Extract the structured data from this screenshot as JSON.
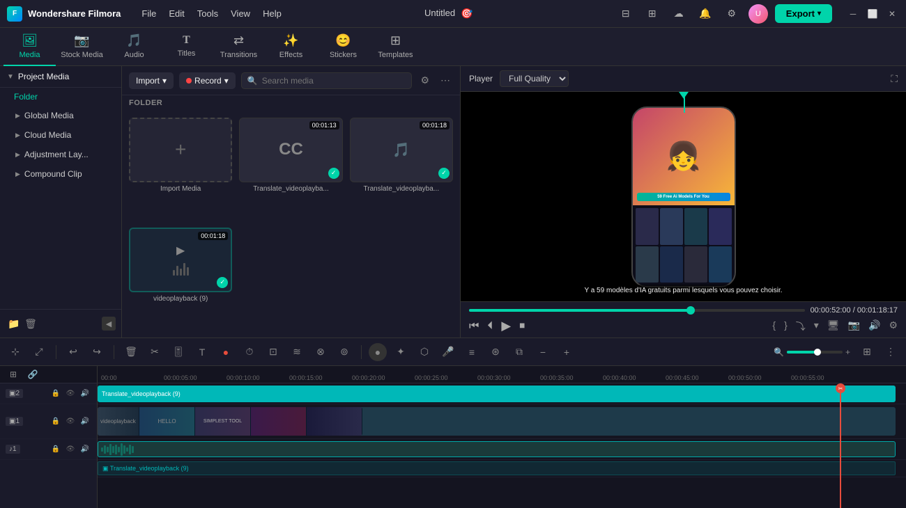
{
  "app": {
    "name": "Wondershare Filmora",
    "project_name": "Untitled"
  },
  "menu": {
    "items": [
      "File",
      "Edit",
      "Tools",
      "View",
      "Help"
    ]
  },
  "nav_tabs": [
    {
      "id": "media",
      "label": "Media",
      "icon": "🖼",
      "active": true
    },
    {
      "id": "stock_media",
      "label": "Stock Media",
      "icon": "📷"
    },
    {
      "id": "audio",
      "label": "Audio",
      "icon": "🎵"
    },
    {
      "id": "titles",
      "label": "Titles",
      "icon": "T"
    },
    {
      "id": "transitions",
      "label": "Transitions",
      "icon": "↔"
    },
    {
      "id": "effects",
      "label": "Effects",
      "icon": "✨"
    },
    {
      "id": "stickers",
      "label": "Stickers",
      "icon": "😊"
    },
    {
      "id": "templates",
      "label": "Templates",
      "icon": "⊞"
    }
  ],
  "sidebar": {
    "project_media": "Project Media",
    "folder": "Folder",
    "items": [
      {
        "label": "Global Media"
      },
      {
        "label": "Cloud Media"
      },
      {
        "label": "Adjustment Lay..."
      },
      {
        "label": "Compound Clip"
      }
    ]
  },
  "media_panel": {
    "import_label": "Import",
    "record_label": "Record",
    "search_placeholder": "Search media",
    "folder_label": "FOLDER",
    "import_media_label": "Import Media",
    "items": [
      {
        "name": "Translate_videoplayba...",
        "duration": "00:01:13",
        "type": "cc"
      },
      {
        "name": "Translate_videoplayba...",
        "duration": "00:01:18",
        "type": "music"
      },
      {
        "name": "videoplayback (9)",
        "duration": "00:01:18",
        "type": "video"
      }
    ]
  },
  "preview": {
    "player_label": "Player",
    "quality_label": "Full Quality",
    "subtitle": "Y a 59 modèles d'IA gratuits parmi lesquels vous pouvez choisir.",
    "badge_text": "59 Free Ai Models For You",
    "current_time": "00:00:52:00",
    "total_time": "00:01:18:17",
    "progress_pct": 66
  },
  "timeline": {
    "ruler_marks": [
      "00:00",
      "00:00:05:00",
      "00:00:10:00",
      "00:00:15:00",
      "00:00:20:00",
      "00:00:25:00",
      "00:00:30:00",
      "00:00:35:00",
      "00:00:40:00",
      "00:00:45:00",
      "00:00:50:00",
      "00:00:55:00"
    ],
    "tracks": [
      {
        "type": "video",
        "label": "2",
        "clip_label": "Translate_videoplayback (9)"
      },
      {
        "type": "video",
        "label": "1",
        "clip_label": "videoplayback"
      },
      {
        "type": "audio",
        "label": "1",
        "clip_label": "Translate_videoplayback (9)"
      }
    ]
  },
  "export_btn": "Export"
}
